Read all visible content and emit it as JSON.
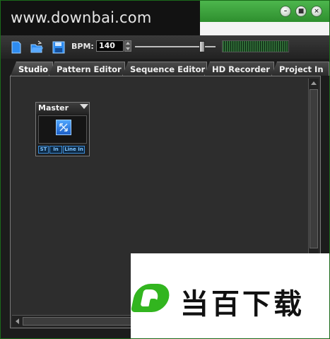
{
  "watermark": {
    "text": "www.downbai.com"
  },
  "window_controls": {
    "minimize": "–",
    "restore": "■",
    "close": "×"
  },
  "toolbar": {
    "bpm_label": "BPM:",
    "bpm_value": "140",
    "tempo_slider": {
      "value": 0.83
    },
    "icons": [
      "new-file-icon",
      "open-folder-icon",
      "save-disk-icon"
    ]
  },
  "tabs": [
    {
      "label": "Studio",
      "active": true
    },
    {
      "label": "Pattern Editor",
      "active": false
    },
    {
      "label": "Sequence Editor",
      "active": false
    },
    {
      "label": "HD Recorder",
      "active": false
    },
    {
      "label": "Project In",
      "active": false
    }
  ],
  "master": {
    "title": "Master",
    "buttons": [
      "ST",
      "In",
      "Line In"
    ]
  },
  "logo": {
    "text": "当百下载"
  },
  "colors": {
    "titlebar": "#3aa83a",
    "logo_green": "#32b51f",
    "master_button": "#3b8bd6"
  }
}
